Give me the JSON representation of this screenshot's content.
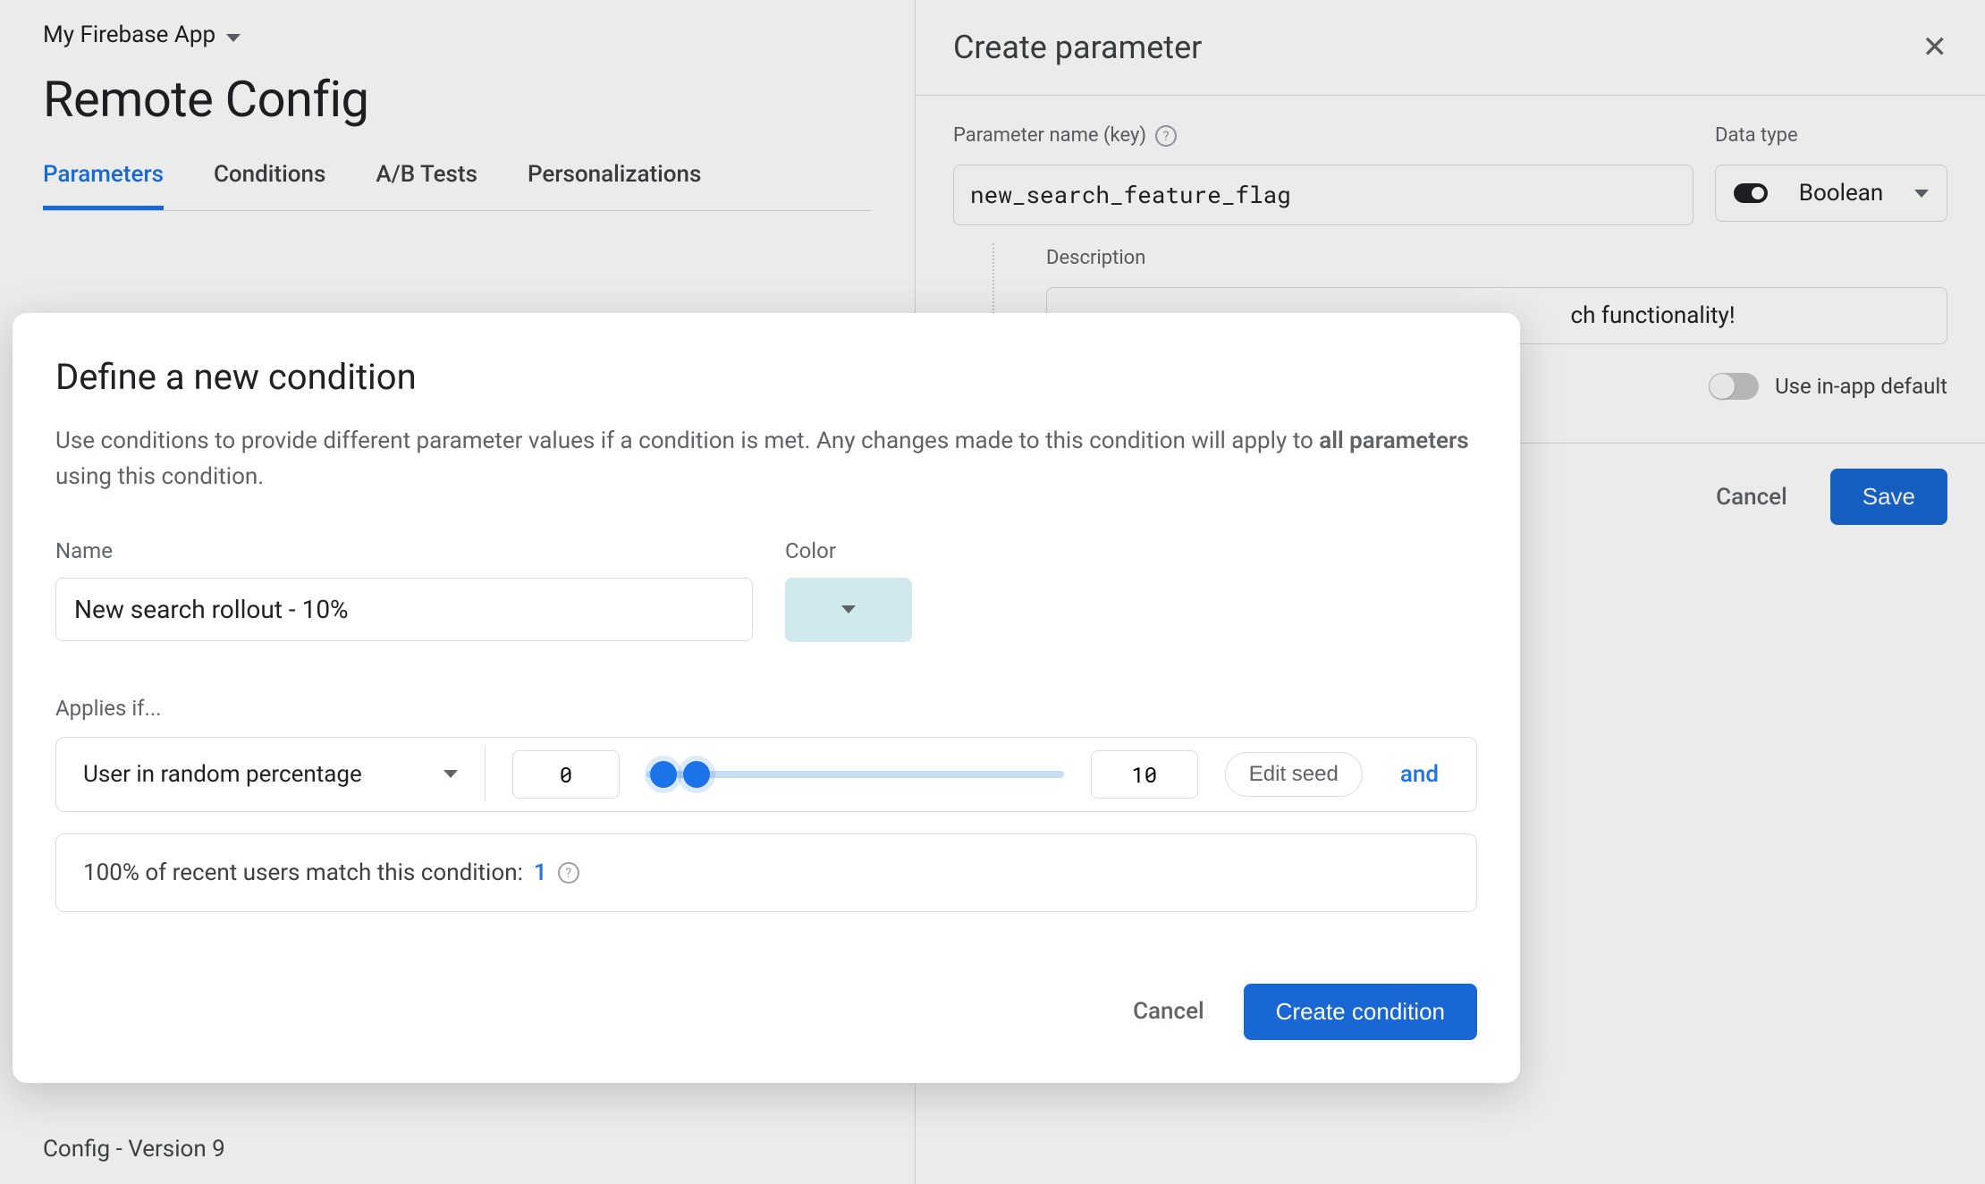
{
  "header": {
    "app_name": "My Firebase App",
    "page_title": "Remote Config",
    "tabs": [
      {
        "label": "Parameters",
        "active": true
      },
      {
        "label": "Conditions",
        "active": false
      },
      {
        "label": "A/B Tests",
        "active": false
      },
      {
        "label": "Personalizations",
        "active": false
      }
    ]
  },
  "side_panel": {
    "title": "Create parameter",
    "param_name_label": "Parameter name (key)",
    "param_name_value": "new_search_feature_flag",
    "data_type_label": "Data type",
    "data_type_value": "Boolean",
    "description_label": "Description",
    "description_value_visible": "ch functionality!",
    "use_in_app_label": "Use in-app default",
    "cancel": "Cancel",
    "save": "Save"
  },
  "modal": {
    "title": "Define a new condition",
    "desc_part1": "Use conditions to provide different parameter values if a condition is met. Any changes made to this condition will apply to ",
    "desc_bold": "all parameters",
    "desc_part2": " using this condition.",
    "name_label": "Name",
    "name_value": "New search rollout - 10%",
    "color_label": "Color",
    "color_value": "#cfe9ec",
    "applies_if_label": "Applies if...",
    "rule_type": "User in random percentage",
    "rule_min": "0",
    "rule_max": "10",
    "edit_seed": "Edit seed",
    "and": "and",
    "match_text": "100% of recent users match this condition: ",
    "match_count": "1",
    "cancel": "Cancel",
    "create": "Create condition"
  },
  "footer": {
    "version_text": "Config - Version 9"
  }
}
